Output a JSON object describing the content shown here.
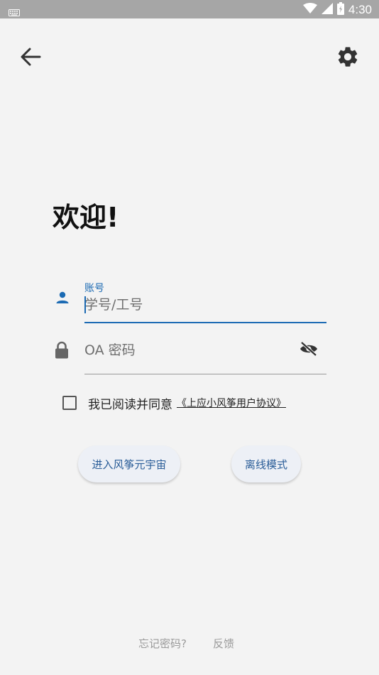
{
  "status_bar": {
    "time": "4:30",
    "icons": [
      "keyboard-icon",
      "wifi-icon",
      "signal-icon",
      "battery-icon"
    ]
  },
  "top_bar": {
    "back_icon": "arrow-left-icon",
    "settings_icon": "gear-icon"
  },
  "welcome": "欢迎!",
  "account": {
    "label": "账号",
    "placeholder": "学号/工号",
    "value": ""
  },
  "password": {
    "placeholder": "OA 密码",
    "value": "",
    "visibility_icon": "eye-off-icon"
  },
  "agreement": {
    "checked": false,
    "text": "我已阅读并同意",
    "link": "《上应小风筝用户协议》"
  },
  "buttons": {
    "enter": "进入风筝元宇宙",
    "offline": "离线模式"
  },
  "footer": {
    "forgot": "忘记密码?",
    "feedback": "反馈"
  },
  "colors": {
    "accent": "#1b6ab3",
    "background": "#f3f3f3",
    "status_bar": "#a6a6a6",
    "button_bg": "#edf0f6",
    "button_text": "#2a5d98"
  }
}
